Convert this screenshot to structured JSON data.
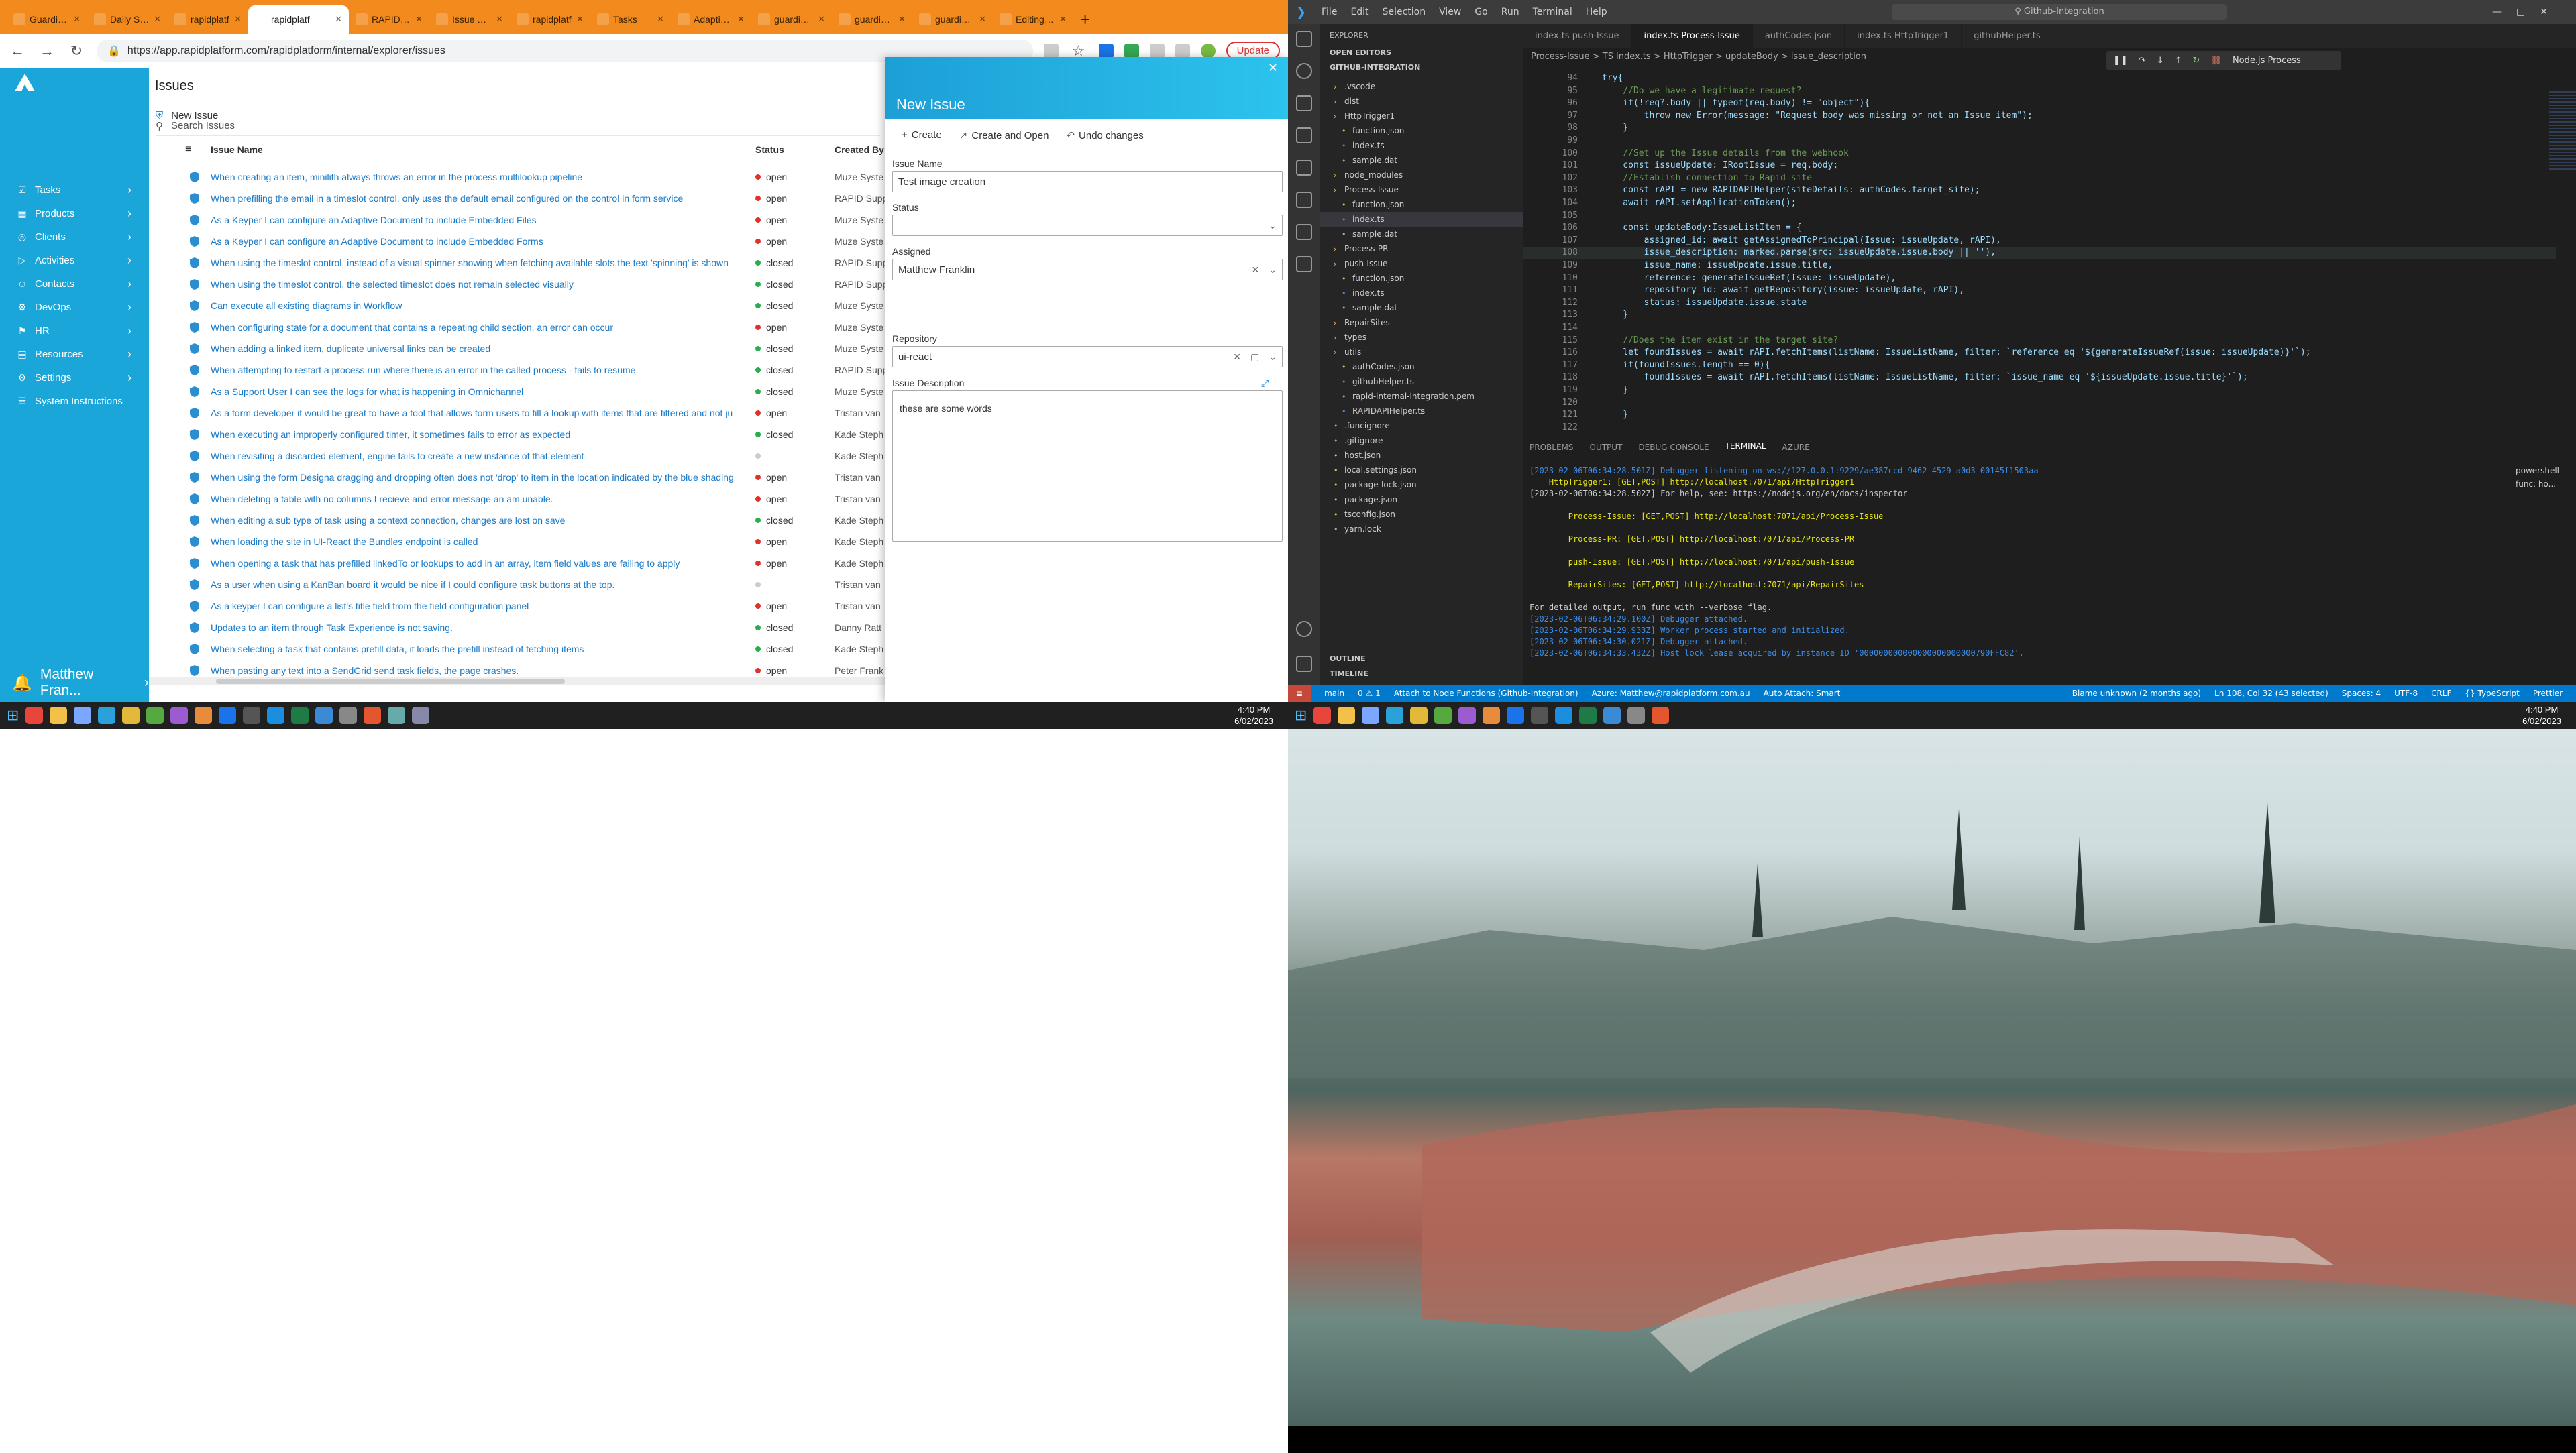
{
  "browser": {
    "tabs": [
      "Guardian Gi",
      "Daily Stan",
      "rapidplatf",
      "rapidplatf",
      "RAPID Port",
      "Issue Triage",
      "rapidplatf",
      "Tasks",
      "Adaptive D",
      "guardianco",
      "guardianco",
      "guardianco",
      "Editing Pos"
    ],
    "url": "https://app.rapidplatform.com/rapidplatform/internal/explorer/issues",
    "update_label": "Update"
  },
  "app": {
    "sidebar": [
      "Tasks",
      "Products",
      "Clients",
      "Activities",
      "Contacts",
      "DevOps",
      "HR",
      "Resources",
      "Settings",
      "System Instructions"
    ],
    "user": "Matthew Fran...",
    "page_title": "Issues",
    "new_issue": "New Issue",
    "search_placeholder": "Search Issues",
    "columns": {
      "name": "Issue Name",
      "status": "Status",
      "by": "Created By"
    },
    "rows": [
      {
        "name": "When creating an item, minilith always throws an error in the process multilookup pipeline",
        "status": "open",
        "by": "Muze Syste"
      },
      {
        "name": "When prefilling the email in a timeslot control, only uses the default email configured on the control in form service",
        "status": "open",
        "by": "RAPID Supp"
      },
      {
        "name": "As a Keyper I can configure an Adaptive Document to include Embedded Files",
        "status": "open",
        "by": "Muze Syste"
      },
      {
        "name": "As a Keyper I can configure an Adaptive Document to include Embedded Forms",
        "status": "open",
        "by": "Muze Syste"
      },
      {
        "name": "When using the timeslot control, instead of a visual spinner showing when fetching available slots the text 'spinning' is shown",
        "status": "closed",
        "by": "RAPID Supp"
      },
      {
        "name": "When using the timeslot control, the selected timeslot does not remain selected visually",
        "status": "closed",
        "by": "RAPID Supp"
      },
      {
        "name": "Can execute all existing diagrams in Workflow",
        "status": "closed",
        "by": "Muze Syste"
      },
      {
        "name": "When configuring state for a document that contains a repeating child section, an error can occur",
        "status": "open",
        "by": "Muze Syste"
      },
      {
        "name": "When adding a linked item, duplicate universal links can be created",
        "status": "closed",
        "by": "Muze Syste"
      },
      {
        "name": "When attempting to restart a process run where there is an error in the called process - fails to resume",
        "status": "closed",
        "by": "RAPID Supp"
      },
      {
        "name": "As a Support User I can see the logs for what is happening in Omnichannel",
        "status": "closed",
        "by": "Muze Syste"
      },
      {
        "name": "As a form developer it would be great to have a tool that allows form users to fill a lookup with items that are filtered and not ju",
        "status": "open",
        "by": "Tristan van"
      },
      {
        "name": "When executing an improperly configured timer, it sometimes fails to error as expected",
        "status": "closed",
        "by": "Kade Steph"
      },
      {
        "name": "When revisiting a discarded element, engine fails to create a new instance of that element",
        "status": "",
        "by": "Kade Steph"
      },
      {
        "name": "When using the form Designa dragging and dropping often does not 'drop' to item in the location indicated by the blue shading",
        "status": "open",
        "by": "Tristan van"
      },
      {
        "name": "When deleting a table with no columns I recieve and error message an am unable.",
        "status": "open",
        "by": "Tristan van"
      },
      {
        "name": "When editing a sub type of task using a context connection, changes are lost on save",
        "status": "closed",
        "by": "Kade Steph"
      },
      {
        "name": "When loading the site in UI-React the Bundles endpoint is called",
        "status": "open",
        "by": "Kade Steph"
      },
      {
        "name": "When opening a task that has prefilled linkedTo or lookups to add in an array, item field values are failing to apply",
        "status": "open",
        "by": "Kade Steph"
      },
      {
        "name": "As a user when using a KanBan board it would be nice if I could configure task buttons at the top.",
        "status": "",
        "by": "Tristan van"
      },
      {
        "name": "As a keyper I can configure a list's title field from the field configuration panel",
        "status": "open",
        "by": "Tristan van"
      },
      {
        "name": "Updates to an item through Task Experience is not saving.",
        "status": "closed",
        "by": "Danny Ratt"
      },
      {
        "name": "When selecting a task that contains prefill data, it loads the prefill instead of fetching items",
        "status": "closed",
        "by": "Kade Steph"
      },
      {
        "name": "When pasting any text into a SendGrid send task fields, the page crashes.",
        "status": "open",
        "by": "Peter Frank"
      }
    ],
    "panel": {
      "title": "New Issue",
      "create": "Create",
      "create_open": "Create and Open",
      "undo": "Undo changes",
      "issue_name_label": "Issue Name",
      "issue_name_value": "Test image creation",
      "status_label": "Status",
      "assigned_label": "Assigned",
      "assigned_value": "Matthew Franklin",
      "repo_label": "Repository",
      "repo_value": "ui-react",
      "desc_label": "Issue Description",
      "desc_value": "these are some words"
    }
  },
  "taskbar": {
    "time": "4:40 PM",
    "date": "6/02/2023"
  },
  "vscode": {
    "menu": [
      "File",
      "Edit",
      "Selection",
      "View",
      "Go",
      "Run",
      "Terminal",
      "Help"
    ],
    "command_center": "Github-Integration",
    "tabs": [
      "index.ts push-Issue",
      "index.ts Process-Issue",
      "authCodes.json",
      "index.ts HttpTrigger1",
      "githubHelper.ts"
    ],
    "breadcrumb": "Process-Issue > TS index.ts > HttpTrigger > updateBody > issue_description",
    "debug_target": "Node.js Process",
    "explorer_title": "EXPLORER",
    "open_editors": "OPEN EDITORS",
    "workspace": "GITHUB-INTEGRATION",
    "tree": [
      ".vscode",
      "dist",
      "HttpTrigger1",
      "function.json",
      "index.ts",
      "sample.dat",
      "node_modules",
      "Process-Issue",
      "function.json",
      "index.ts",
      "sample.dat",
      "Process-PR",
      "push-Issue",
      "function.json",
      "index.ts",
      "sample.dat",
      "RepairSites",
      "types",
      "utils",
      "authCodes.json",
      "githubHelper.ts",
      "rapid-internal-integration.pem",
      "RAPIDAPIHelper.ts",
      ".funcignore",
      ".gitignore",
      "host.json",
      "local.settings.json",
      "package-lock.json",
      "package.json",
      "tsconfig.json",
      "yarn.lock"
    ],
    "outline": "OUTLINE",
    "timeline": "TIMELINE",
    "panel_tabs": [
      "PROBLEMS",
      "OUTPUT",
      "DEBUG CONSOLE",
      "TERMINAL",
      "AZURE"
    ],
    "term_side": [
      "powershell",
      "func: ho..."
    ],
    "status": [
      "main",
      "0 ⚠ 1",
      "Attach to Node Functions (Github-Integration)",
      "Azure: Matthew@rapidplatform.com.au",
      "Auto Attach: Smart",
      "Blame unknown (2 months ago)",
      "Ln 108, Col 32 (43 selected)",
      "Spaces: 4",
      "UTF-8",
      "CRLF",
      "{} TypeScript",
      "Prettier"
    ],
    "code_lines": [
      [
        "94",
        "try{"
      ],
      [
        "95",
        "    //Do we have a legitimate request?"
      ],
      [
        "96",
        "    if(!req?.body || typeof(req.body) != \"object\"){"
      ],
      [
        "97",
        "        throw new Error(message: \"Request body was missing or not an Issue item\");"
      ],
      [
        "98",
        "    }"
      ],
      [
        "99",
        ""
      ],
      [
        "100",
        "    //Set up the Issue details from the webhook"
      ],
      [
        "101",
        "    const issueUpdate: IRootIssue = req.body;"
      ],
      [
        "102",
        "    //Establish connection to Rapid site"
      ],
      [
        "103",
        "    const rAPI = new RAPIDAPIHelper(siteDetails: authCodes.target_site);"
      ],
      [
        "104",
        "    await rAPI.setApplicationToken();"
      ],
      [
        "105",
        ""
      ],
      [
        "106",
        "    const updateBody:IssueListItem = {"
      ],
      [
        "107",
        "        assigned_id: await getAssignedToPrincipal(Issue: issueUpdate, rAPI),"
      ],
      [
        "108",
        "        issue_description: marked.parse(src: issueUpdate.issue.body || ''),"
      ],
      [
        "109",
        "        issue_name: issueUpdate.issue.title,"
      ],
      [
        "110",
        "        reference: generateIssueRef(Issue: issueUpdate),"
      ],
      [
        "111",
        "        repository_id: await getRepository(issue: issueUpdate, rAPI),"
      ],
      [
        "112",
        "        status: issueUpdate.issue.state"
      ],
      [
        "113",
        "    }"
      ],
      [
        "114",
        ""
      ],
      [
        "115",
        "    //Does the item exist in the target site?"
      ],
      [
        "116",
        "    let foundIssues = await rAPI.fetchItems(listName: IssueListName, filter: `reference eq '${generateIssueRef(issue: issueUpdate)}'`);"
      ],
      [
        "117",
        "    if(foundIssues.length == 0){"
      ],
      [
        "118",
        "        foundIssues = await rAPI.fetchItems(listName: IssueListName, filter: `issue_name eq '${issueUpdate.issue.title}'`);"
      ],
      [
        "119",
        "    }"
      ],
      [
        "120",
        ""
      ],
      [
        "121",
        "    }"
      ],
      [
        "122",
        ""
      ]
    ],
    "terminal": [
      "[2023-02-06T06:34:28.501Z] Debugger listening on ws://127.0.0.1:9229/ae387ccd-9462-4529-a0d3-00145f1503aa",
      "    HttpTrigger1: [GET,POST] http://localhost:7071/api/HttpTrigger1",
      "[2023-02-06T06:34:28.502Z] For help, see: https://nodejs.org/en/docs/inspector",
      "",
      "        Process-Issue: [GET,POST] http://localhost:7071/api/Process-Issue",
      "",
      "        Process-PR: [GET,POST] http://localhost:7071/api/Process-PR",
      "",
      "        push-Issue: [GET,POST] http://localhost:7071/api/push-Issue",
      "",
      "        RepairSites: [GET,POST] http://localhost:7071/api/RepairSites",
      "",
      "For detailed output, run func with --verbose flag.",
      "[2023-02-06T06:34:29.100Z] Debugger attached.",
      "[2023-02-06T06:34:29.933Z] Worker process started and initialized.",
      "[2023-02-06T06:34:30.021Z] Debugger attached.",
      "[2023-02-06T06:34:33.432Z] Host lock lease acquired by instance ID '000000000000000000000000790FFC82'."
    ]
  },
  "colors": {
    "orange": "#f28a1d",
    "rapid_blue": "#1aa6d8",
    "open": "#e0312b",
    "closed": "#27ae4f",
    "vscode_status": "#007acc"
  }
}
